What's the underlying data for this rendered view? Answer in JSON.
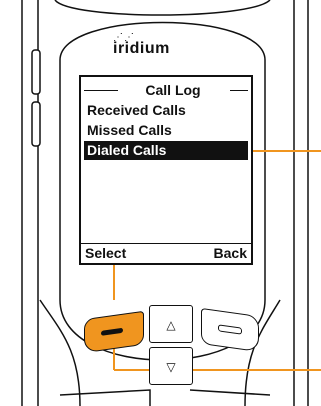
{
  "brand": {
    "name": "iridium",
    "dots": "⋰⋰"
  },
  "screen": {
    "title": "Call Log",
    "items": [
      {
        "label": "Received Calls",
        "selected": false
      },
      {
        "label": "Missed Calls",
        "selected": false
      },
      {
        "label": "Dialed Calls",
        "selected": true
      }
    ],
    "softkeys": {
      "left": "Select",
      "right": "Back"
    }
  },
  "keys": {
    "nav_up_glyph": "△",
    "nav_down_glyph": "▽"
  },
  "colors": {
    "accent": "#f0951f",
    "callout": "#f0951f",
    "selection": "#111111"
  }
}
